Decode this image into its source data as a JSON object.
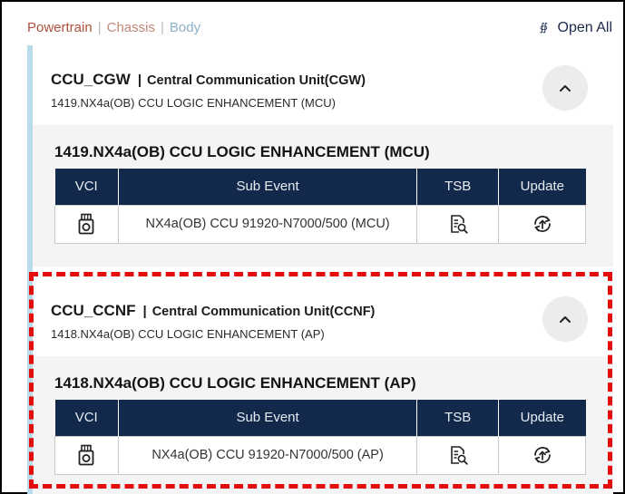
{
  "nav": {
    "tabs": [
      "Powertrain",
      "Chassis",
      "Body"
    ],
    "separator": "|",
    "open_all_label": "Open All"
  },
  "table_headers": {
    "vci": "VCI",
    "sub_event": "Sub Event",
    "tsb": "TSB",
    "update": "Update"
  },
  "sections": [
    {
      "code": "CCU_CGW",
      "separator": "|",
      "name": "Central Communication Unit(CGW)",
      "subtitle": "1419.NX4a(OB) CCU LOGIC ENHANCEMENT (MCU)",
      "body_title": "1419.NX4a(OB) CCU LOGIC ENHANCEMENT (MCU)",
      "row": {
        "sub_event": "NX4a(OB) CCU 91920-N7000/500 (MCU)"
      }
    },
    {
      "code": "CCU_CCNF",
      "separator": "|",
      "name": "Central Communication Unit(CCNF)",
      "subtitle": "1418.NX4a(OB) CCU LOGIC ENHANCEMENT (AP)",
      "body_title": "1418.NX4a(OB) CCU LOGIC ENHANCEMENT (AP)",
      "row": {
        "sub_event": "NX4a(OB) CCU 91920-N7000/500 (AP)"
      }
    }
  ],
  "colors": {
    "header_navy": "#13294b",
    "accent_blue": "#b9dcea",
    "highlight_red": "#e30d0d"
  },
  "icons": {
    "vci": "vci-device-icon",
    "tsb": "tsb-document-search-icon",
    "update": "update-cloud-icon",
    "collapse": "chevron-up-icon",
    "open_all": "double-chevron-down-icon"
  }
}
